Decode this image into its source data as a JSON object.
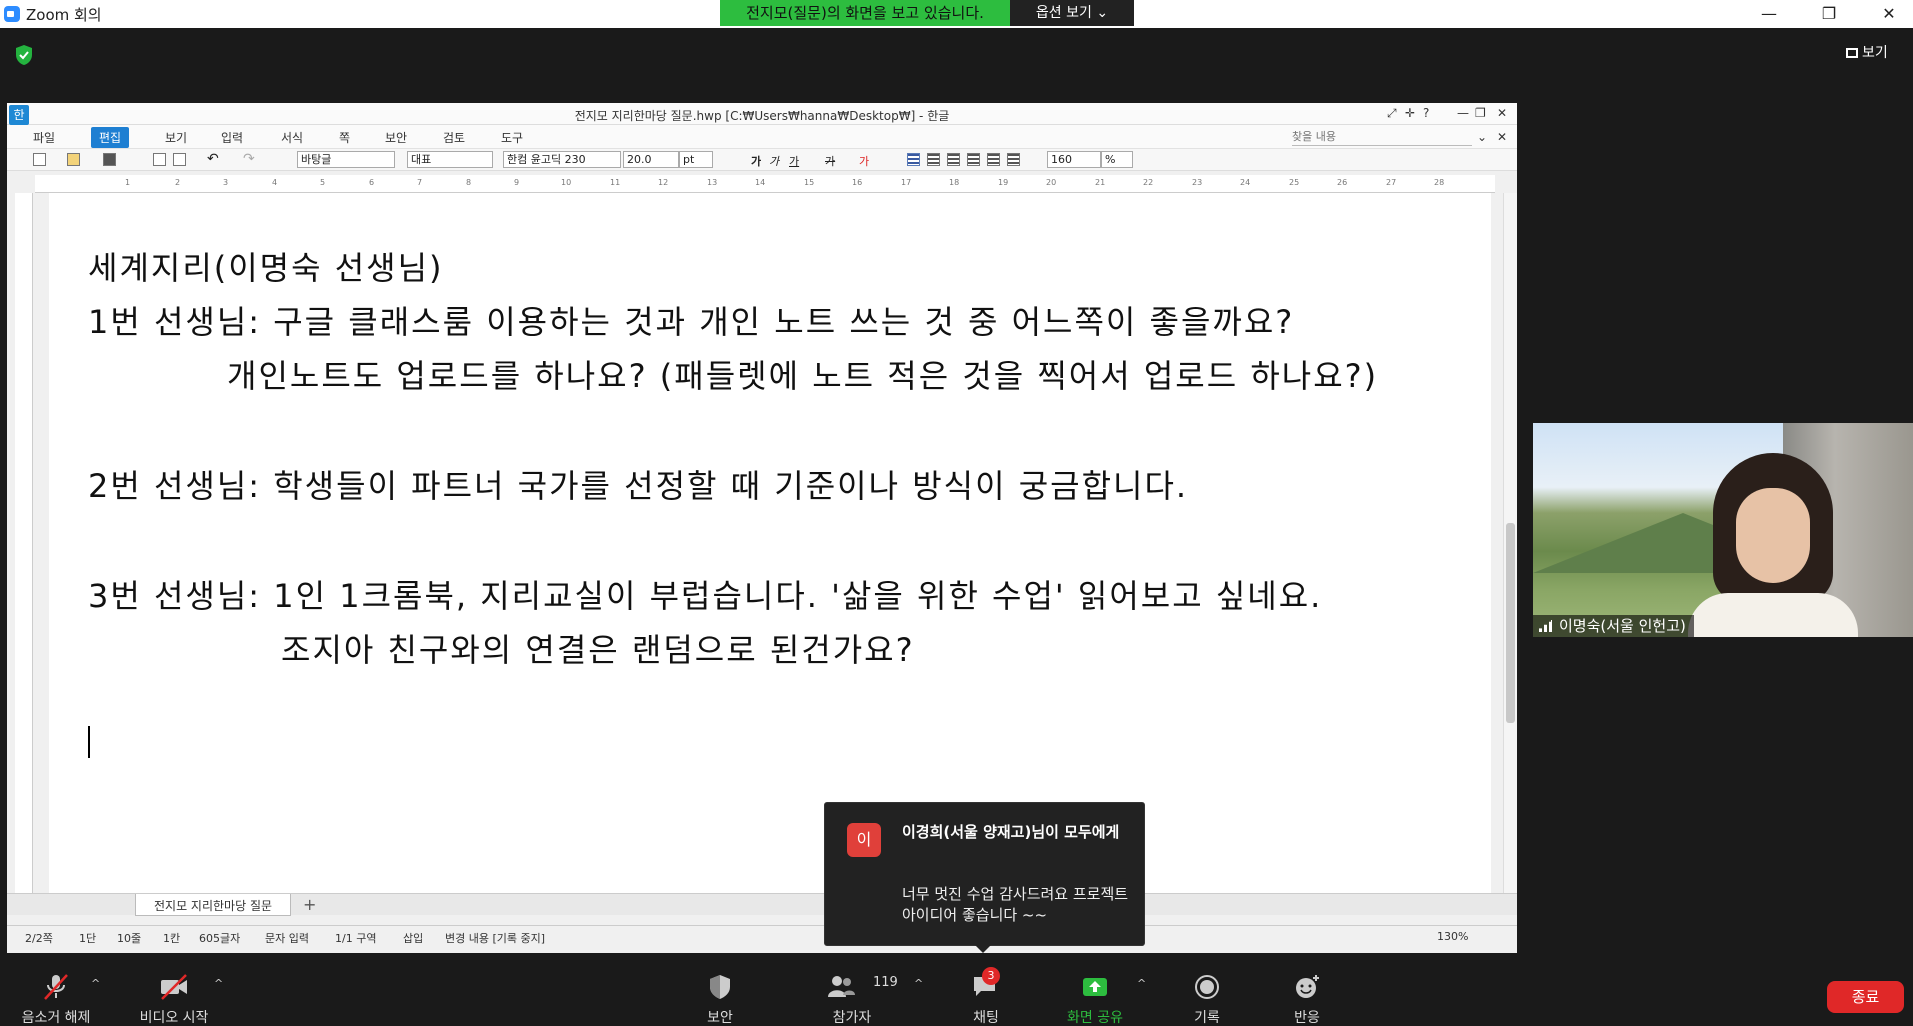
{
  "zoom": {
    "window_title": "Zoom 회의",
    "sharing_banner": "전지모(질문)의 화면을 보고 있습니다.",
    "view_options": "옵션 보기 ⌄",
    "view_button": "보기",
    "controls": {
      "audio": "음소거 해제",
      "video": "비디오 시작",
      "security": "보안",
      "participants": "참가자",
      "participants_count": "119",
      "chat": "채팅",
      "chat_unread": "3",
      "share": "화면 공유",
      "record": "기록",
      "reactions": "반응",
      "end": "종료"
    },
    "colors": {
      "share_green": "#2dbd3f",
      "end_red": "#e02828",
      "banner_green": "#2dbd3f"
    }
  },
  "hwp": {
    "logo": "한",
    "title": "전지모 지리한마당 질문.hwp [C:₩Users₩hanna₩Desktop₩] - 한글",
    "menus": [
      "파일",
      "편집",
      "보기",
      "입력",
      "서식",
      "쪽",
      "보안",
      "검토",
      "도구"
    ],
    "find_placeholder": "찾을 내용",
    "toolbar": {
      "style": "바탕글",
      "style2": "대표",
      "font": "한컴 윤고딕 230",
      "size": "20.0",
      "unit": "pt",
      "zoom": "160",
      "zoom_unit": "%"
    },
    "ruler_numbers": [
      "1",
      "2",
      "3",
      "4",
      "5",
      "6",
      "7",
      "8",
      "9",
      "10",
      "11",
      "12",
      "13",
      "14",
      "15",
      "16",
      "17",
      "18",
      "19",
      "20",
      "21",
      "22",
      "23",
      "24",
      "25",
      "26",
      "27",
      "28"
    ],
    "document": {
      "heading": "세계지리(이명숙 선생님)",
      "q1a": "1번 선생님: 구글 클래스룸 이용하는 것과 개인 노트 쓰는 것 중 어느쪽이 좋을까요?",
      "q1b": "개인노트도 업로드를 하나요? (패들렛에 노트 적은 것을 찍어서 업로드 하나요?)",
      "q2": "2번 선생님: 학생들이 파트너 국가를 선정할 때 기준이나 방식이 궁금합니다.",
      "q3a": "3번 선생님: 1인 1크롬북, 지리교실이 부럽습니다. '삶을 위한 수업' 읽어보고 싶네요.",
      "q3b": "조지아 친구와의 연결은 랜덤으로 된건가요?"
    },
    "tab_name": "전지모 지리한마당 질문",
    "status": {
      "page": "2/2쪽",
      "column": "1단",
      "line": "10줄",
      "col": "1칸",
      "chars": "605글자",
      "input_mode": "문자 입력",
      "section": "1/1 구역",
      "insert": "삽입",
      "changes": "변경 내용 [기록 중지]",
      "zoom": "130%"
    }
  },
  "participant": {
    "name": "이명숙(서울 인헌고)"
  },
  "chat_toast": {
    "avatar_initial": "이",
    "sender": "이경희(서울 양재고)님이 모두에게",
    "message": "너무 멋진 수업 감사드려요 프로젝트 아이디어 좋습니다 ~~"
  }
}
